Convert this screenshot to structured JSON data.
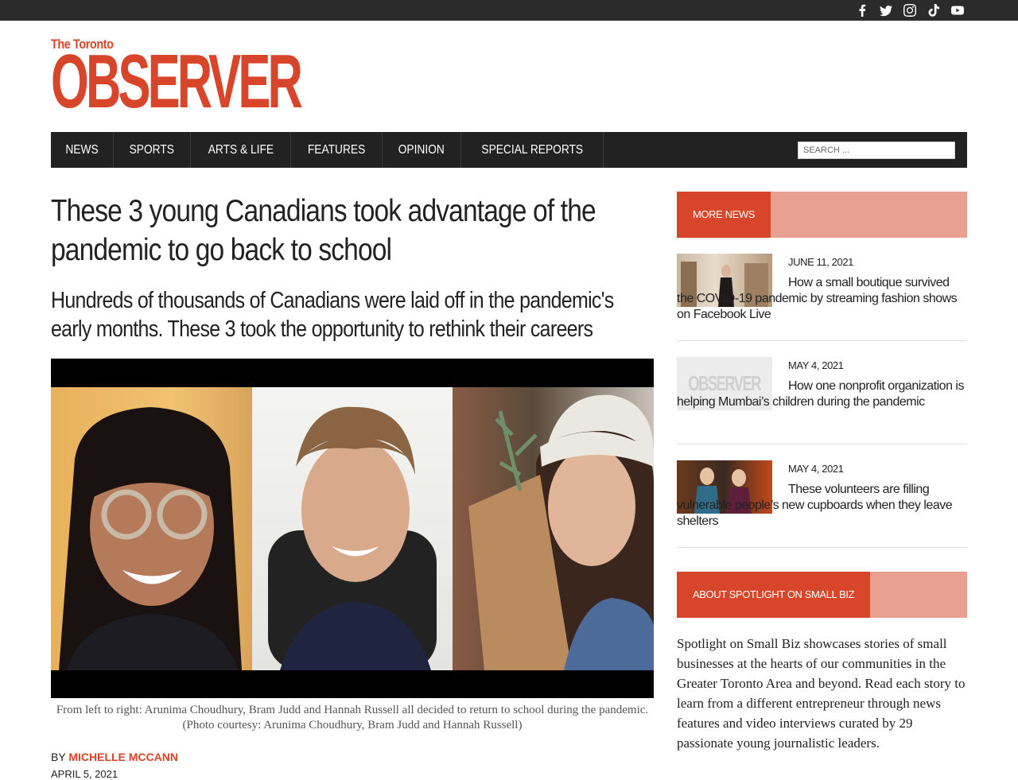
{
  "social": [
    "facebook-icon",
    "twitter-icon",
    "instagram-icon",
    "tiktok-icon",
    "youtube-icon"
  ],
  "logo": {
    "small": "The Toronto",
    "big": "OBSERVER"
  },
  "nav": [
    "NEWS",
    "SPORTS",
    "ARTS & LIFE",
    "FEATURES",
    "OPINION",
    "SPECIAL REPORTS"
  ],
  "search": {
    "placeholder": "SEARCH ..."
  },
  "article": {
    "headline": "These 3 young Canadians took advantage of the pandemic to go back to school",
    "subhead": "Hundreds of thousands of Canadians were laid off in the pandemic's early months. These 3 took the opportunity to rethink their careers",
    "caption": "From left to right: Arunima Choudhury, Bram Judd and Hannah Russell all decided to return to school during the pandemic. (Photo courtesy: Arunima Choudhury, Bram Judd and Hannah Russell)",
    "by_prefix": "BY",
    "author": "MICHELLE MCCANN",
    "date": "APRIL 5, 2021"
  },
  "sidebar": {
    "more_news_label": "MORE NEWS",
    "items": [
      {
        "date": "JUNE 11, 2021",
        "title": "How a small boutique survived the COVID-19 pandemic by streaming fashion shows on Facebook Live"
      },
      {
        "date": "MAY 4, 2021",
        "title": "How one nonprofit organization is helping Mumbai’s children during the pandemic",
        "thumb_text": "OBSERVER"
      },
      {
        "date": "MAY 4, 2021",
        "title": "These volunteers are filling vulnerable people’s new cupboards when they leave shelters"
      }
    ],
    "about_label": "ABOUT SPOTLIGHT ON SMALL BIZ",
    "about_text": "Spotlight on Small Biz showcases stories of small businesses at the hearts of our communities in the Greater Toronto Area and beyond. Read each story to learn from a different entrepreneur through news features and video interviews curated by 29 passionate young journalistic leaders."
  },
  "colors": {
    "brand": "#d7452a",
    "brand_light": "#e8a091",
    "nav_bg": "#222222"
  }
}
